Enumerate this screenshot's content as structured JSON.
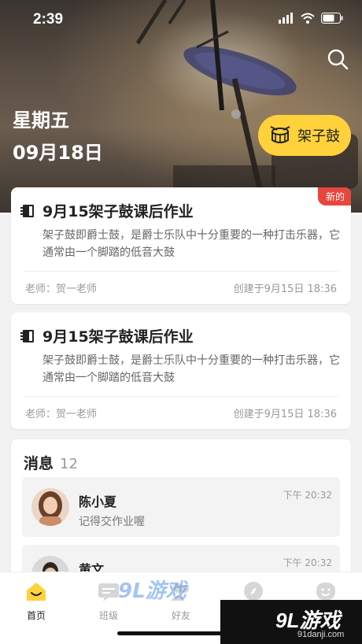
{
  "status": {
    "time": "2:39"
  },
  "hero": {
    "weekday": "星期五",
    "date": "09月18日",
    "category": {
      "label": "架子鼓",
      "icon": "drum-icon"
    }
  },
  "homework": [
    {
      "badge": "新的",
      "title": "9月15架子鼓课后作业",
      "description": "架子鼓即爵士鼓，是爵士乐队中十分重要的一种打击乐器，它通常由一个脚踏的低音大鼓",
      "teacher": "老师：贺一老师",
      "created": "创建于9月15日 18:36"
    },
    {
      "title": "9月15架子鼓课后作业",
      "description": "架子鼓即爵士鼓，是爵士乐队中十分重要的一种打击乐器，它通常由一个脚踏的低音大鼓",
      "teacher": "老师：贺一老师",
      "created": "创建于9月15日 18:36"
    }
  ],
  "messages": {
    "title": "消息",
    "count": "12",
    "items": [
      {
        "name": "陈小夏",
        "preview": "记得交作业喔",
        "time": "下午 20:32"
      },
      {
        "name": "黄文",
        "preview": "",
        "time": "下午 20:32"
      }
    ]
  },
  "tabs": [
    {
      "label": "首页",
      "icon": "home-icon",
      "active": true
    },
    {
      "label": "班级",
      "icon": "class-icon"
    },
    {
      "label": "好友",
      "icon": "friends-icon"
    },
    {
      "label": "",
      "icon": "compass-icon"
    },
    {
      "label": "",
      "icon": "profile-icon"
    }
  ],
  "watermark": {
    "logo": "9L游戏",
    "url": "91danji.com",
    "mid": "9L游戏"
  },
  "colors": {
    "accent": "#ffd23c",
    "badge": "#e8453c"
  }
}
